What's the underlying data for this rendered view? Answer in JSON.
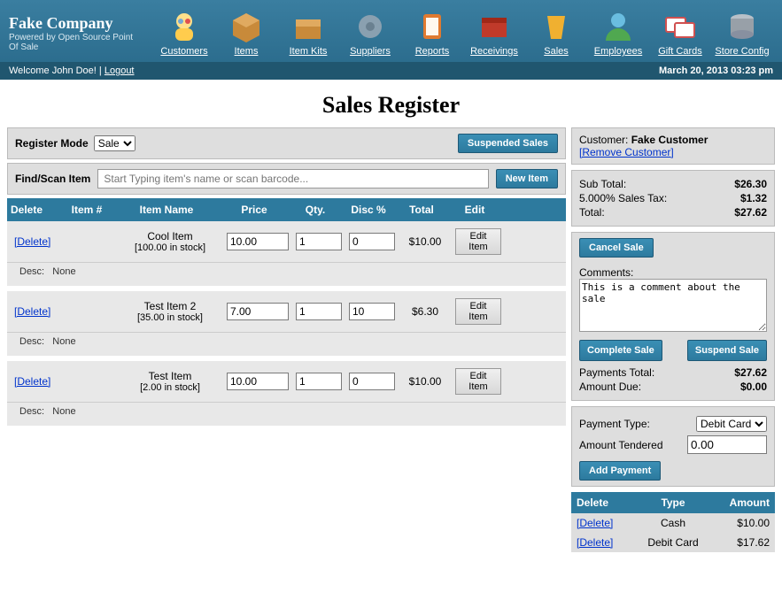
{
  "brand": {
    "name": "Fake Company",
    "tagline": "Powered by Open Source Point Of Sale"
  },
  "nav": [
    {
      "key": "customers",
      "label": "Customers"
    },
    {
      "key": "items",
      "label": "Items"
    },
    {
      "key": "item-kits",
      "label": "Item Kits"
    },
    {
      "key": "suppliers",
      "label": "Suppliers"
    },
    {
      "key": "reports",
      "label": "Reports"
    },
    {
      "key": "receivings",
      "label": "Receivings"
    },
    {
      "key": "sales",
      "label": "Sales"
    },
    {
      "key": "employees",
      "label": "Employees"
    },
    {
      "key": "gift-cards",
      "label": "Gift Cards"
    },
    {
      "key": "store-config",
      "label": "Store Config"
    }
  ],
  "status": {
    "welcome_prefix": "Welcome ",
    "user_name": "John Doe!",
    "divider": " | ",
    "logout": "Logout",
    "datetime": "March 20, 2013 03:23 pm"
  },
  "page_title": "Sales Register",
  "register": {
    "mode_label": "Register Mode",
    "mode_value": "Sale",
    "mode_options": [
      "Sale"
    ],
    "suspended_label": "Suspended Sales",
    "find_label": "Find/Scan Item",
    "find_placeholder": "Start Typing item's name or scan barcode...",
    "new_item_label": "New Item"
  },
  "items_header": {
    "delete": "Delete",
    "item_num": "Item #",
    "item_name": "Item Name",
    "price": "Price",
    "qty": "Qty.",
    "disc": "Disc %",
    "total": "Total",
    "edit": "Edit"
  },
  "items": [
    {
      "delete": "[Delete]",
      "name": "Cool Item",
      "stock": "[100.00 in stock]",
      "price": "10.00",
      "qty": "1",
      "disc": "0",
      "total": "$10.00",
      "edit": "Edit Item",
      "desc_label": "Desc:",
      "desc": "None"
    },
    {
      "delete": "[Delete]",
      "name": "Test Item 2",
      "stock": "[35.00 in stock]",
      "price": "7.00",
      "qty": "1",
      "disc": "10",
      "total": "$6.30",
      "edit": "Edit Item",
      "desc_label": "Desc:",
      "desc": "None"
    },
    {
      "delete": "[Delete]",
      "name": "Test Item",
      "stock": "[2.00 in stock]",
      "price": "10.00",
      "qty": "1",
      "disc": "0",
      "total": "$10.00",
      "edit": "Edit Item",
      "desc_label": "Desc:",
      "desc": "None"
    }
  ],
  "customer": {
    "label": "Customer:",
    "name": "Fake Customer",
    "remove": "[Remove Customer]"
  },
  "totals": {
    "subtotal_label": "Sub Total:",
    "subtotal": "$26.30",
    "tax_label": "5.000% Sales Tax:",
    "tax": "$1.32",
    "total_label": "Total:",
    "total": "$27.62"
  },
  "actions": {
    "cancel_sale": "Cancel Sale",
    "comments_label": "Comments:",
    "comments_value": "This is a comment about the sale",
    "complete_sale": "Complete Sale",
    "suspend_sale": "Suspend Sale"
  },
  "payments": {
    "payments_total_label": "Payments Total:",
    "payments_total": "$27.62",
    "amount_due_label": "Amount Due:",
    "amount_due": "$0.00",
    "type_label": "Payment Type:",
    "type_value": "Debit Card",
    "type_options": [
      "Debit Card"
    ],
    "tendered_label": "Amount Tendered",
    "tendered_value": "0.00",
    "add_payment": "Add Payment",
    "header": {
      "delete": "Delete",
      "type": "Type",
      "amount": "Amount"
    },
    "rows": [
      {
        "delete": "[Delete]",
        "type": "Cash",
        "amount": "$10.00"
      },
      {
        "delete": "[Delete]",
        "type": "Debit Card",
        "amount": "$17.62"
      }
    ]
  }
}
